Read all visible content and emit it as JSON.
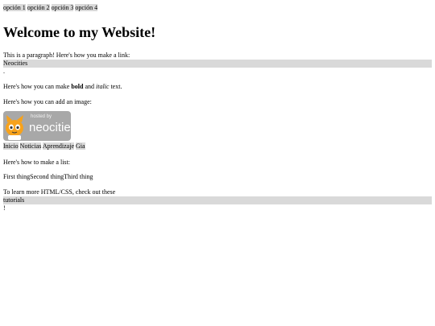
{
  "top_nav": [
    "opción 1",
    "opción 2",
    "opción 3",
    "opción 4"
  ],
  "heading": "Welcome to my Website!",
  "para1": "This is a paragraph! Here's how you make a link:",
  "link_text": "Neocities",
  "period": ".",
  "bold_line": {
    "prefix": "Here's how you can make ",
    "bold": "bold",
    "middle": " and ",
    "italic": "italic",
    "suffix": " text."
  },
  "image_line": "Here's how you can add an image:",
  "logo": {
    "small_text": "hosted by",
    "big_text": "neocities"
  },
  "nav2": [
    "Inicio",
    "Noticias",
    "Aprendizaje",
    "Gia"
  ],
  "list_intro": "Here's how to make a list:",
  "list_items": [
    "First thing",
    "Second thing",
    "Third thing"
  ],
  "learn_more": "To learn more HTML/CSS, check out these",
  "tutorials_link": "tutorials",
  "exclaim": "!"
}
